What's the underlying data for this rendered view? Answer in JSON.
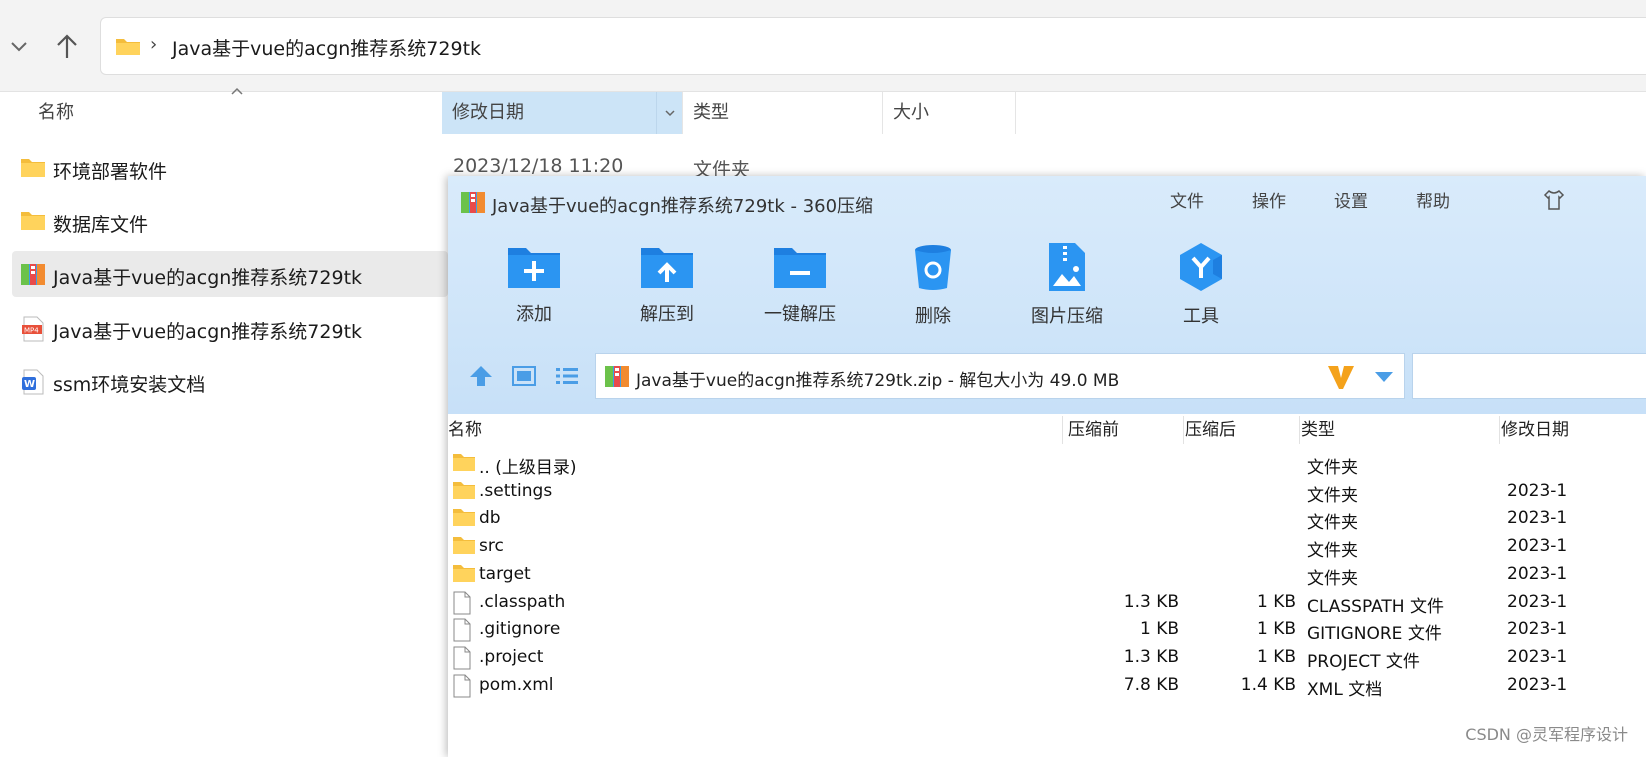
{
  "explorer": {
    "path": "Java基于vue的acgn推荐系统729tk",
    "path_sep": "›",
    "columns": {
      "name": "名称",
      "date": "修改日期",
      "type": "类型",
      "size": "大小"
    },
    "items": [
      {
        "name": "环境部署软件",
        "icon": "folder-icon",
        "date": "2023/12/18 11:20",
        "type": "文件夹"
      },
      {
        "name": "数据库文件",
        "icon": "folder-icon"
      },
      {
        "name": "Java基于vue的acgn推荐系统729tk",
        "icon": "zip-archive-icon",
        "selected": true
      },
      {
        "name": "Java基于vue的acgn推荐系统729tk",
        "icon": "mp4-file-icon"
      },
      {
        "name": "ssm环境安装文档",
        "icon": "word-doc-icon"
      }
    ]
  },
  "zip": {
    "title": "Java基于vue的acgn推荐系统729tk - 360压缩",
    "menu": [
      "文件",
      "操作",
      "设置",
      "帮助"
    ],
    "tools": [
      {
        "label": "添加",
        "icon": "add-folder-icon"
      },
      {
        "label": "解压到",
        "icon": "extract-to-icon"
      },
      {
        "label": "一键解压",
        "icon": "one-click-extract-icon"
      },
      {
        "label": "删除",
        "icon": "recycle-bin-icon"
      },
      {
        "label": "图片压缩",
        "icon": "image-compress-icon"
      },
      {
        "label": "工具",
        "icon": "tools-icon"
      }
    ],
    "address": "Java基于vue的acgn推荐系统729tk.zip - 解包大小为 49.0 MB",
    "columns": {
      "name": "名称",
      "before": "压缩前",
      "after": "压缩后",
      "type": "类型",
      "date": "修改日期"
    },
    "rows": [
      {
        "name": ".. (上级目录)",
        "icon": "folder-icon",
        "before": "",
        "after": "",
        "type": "文件夹",
        "date": ""
      },
      {
        "name": ".settings",
        "icon": "folder-icon",
        "before": "",
        "after": "",
        "type": "文件夹",
        "date": "2023-1"
      },
      {
        "name": "db",
        "icon": "folder-icon",
        "before": "",
        "after": "",
        "type": "文件夹",
        "date": "2023-1"
      },
      {
        "name": "src",
        "icon": "folder-icon",
        "before": "",
        "after": "",
        "type": "文件夹",
        "date": "2023-1"
      },
      {
        "name": "target",
        "icon": "folder-icon",
        "before": "",
        "after": "",
        "type": "文件夹",
        "date": "2023-1"
      },
      {
        "name": ".classpath",
        "icon": "file-icon",
        "before": "1.3 KB",
        "after": "1 KB",
        "type": "CLASSPATH 文件",
        "date": "2023-1"
      },
      {
        "name": ".gitignore",
        "icon": "file-icon",
        "before": "1 KB",
        "after": "1 KB",
        "type": "GITIGNORE 文件",
        "date": "2023-1"
      },
      {
        "name": ".project",
        "icon": "file-icon",
        "before": "1.3 KB",
        "after": "1 KB",
        "type": "PROJECT 文件",
        "date": "2023-1"
      },
      {
        "name": "pom.xml",
        "icon": "file-icon",
        "before": "7.8 KB",
        "after": "1.4 KB",
        "type": "XML 文档",
        "date": "2023-1"
      }
    ]
  },
  "watermark": "CSDN @灵军程序设计",
  "colors": {
    "accent": "#1e8bea",
    "folder": "#f4bd3c",
    "selection": "#cce4f7",
    "zip_panel": "#d4e8fa"
  }
}
